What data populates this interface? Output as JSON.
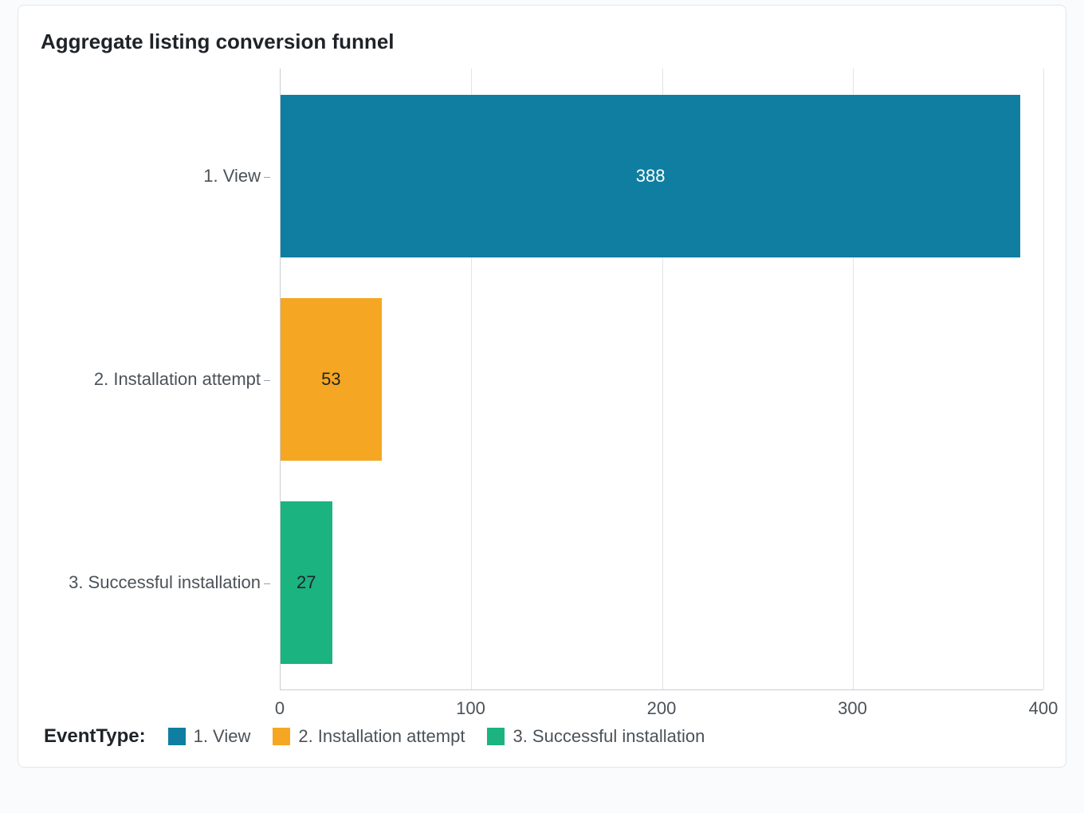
{
  "title": "Aggregate listing conversion funnel",
  "chart_data": {
    "type": "bar",
    "orientation": "horizontal",
    "categories": [
      "1. View",
      "2. Installation attempt",
      "3. Successful installation"
    ],
    "values": [
      388,
      53,
      27
    ],
    "colors": [
      "#0f7ea1",
      "#f5a623",
      "#1bb380"
    ],
    "xlim": [
      0,
      400
    ],
    "xticks": [
      0,
      100,
      200,
      300,
      400
    ],
    "xlabel": "",
    "ylabel": "",
    "title": "Aggregate listing conversion funnel"
  },
  "legend": {
    "title": "EventType:",
    "items": [
      {
        "label": "1. View",
        "color": "#0f7ea1"
      },
      {
        "label": "2. Installation attempt",
        "color": "#f5a623"
      },
      {
        "label": "3. Successful installation",
        "color": "#1bb380"
      }
    ]
  }
}
